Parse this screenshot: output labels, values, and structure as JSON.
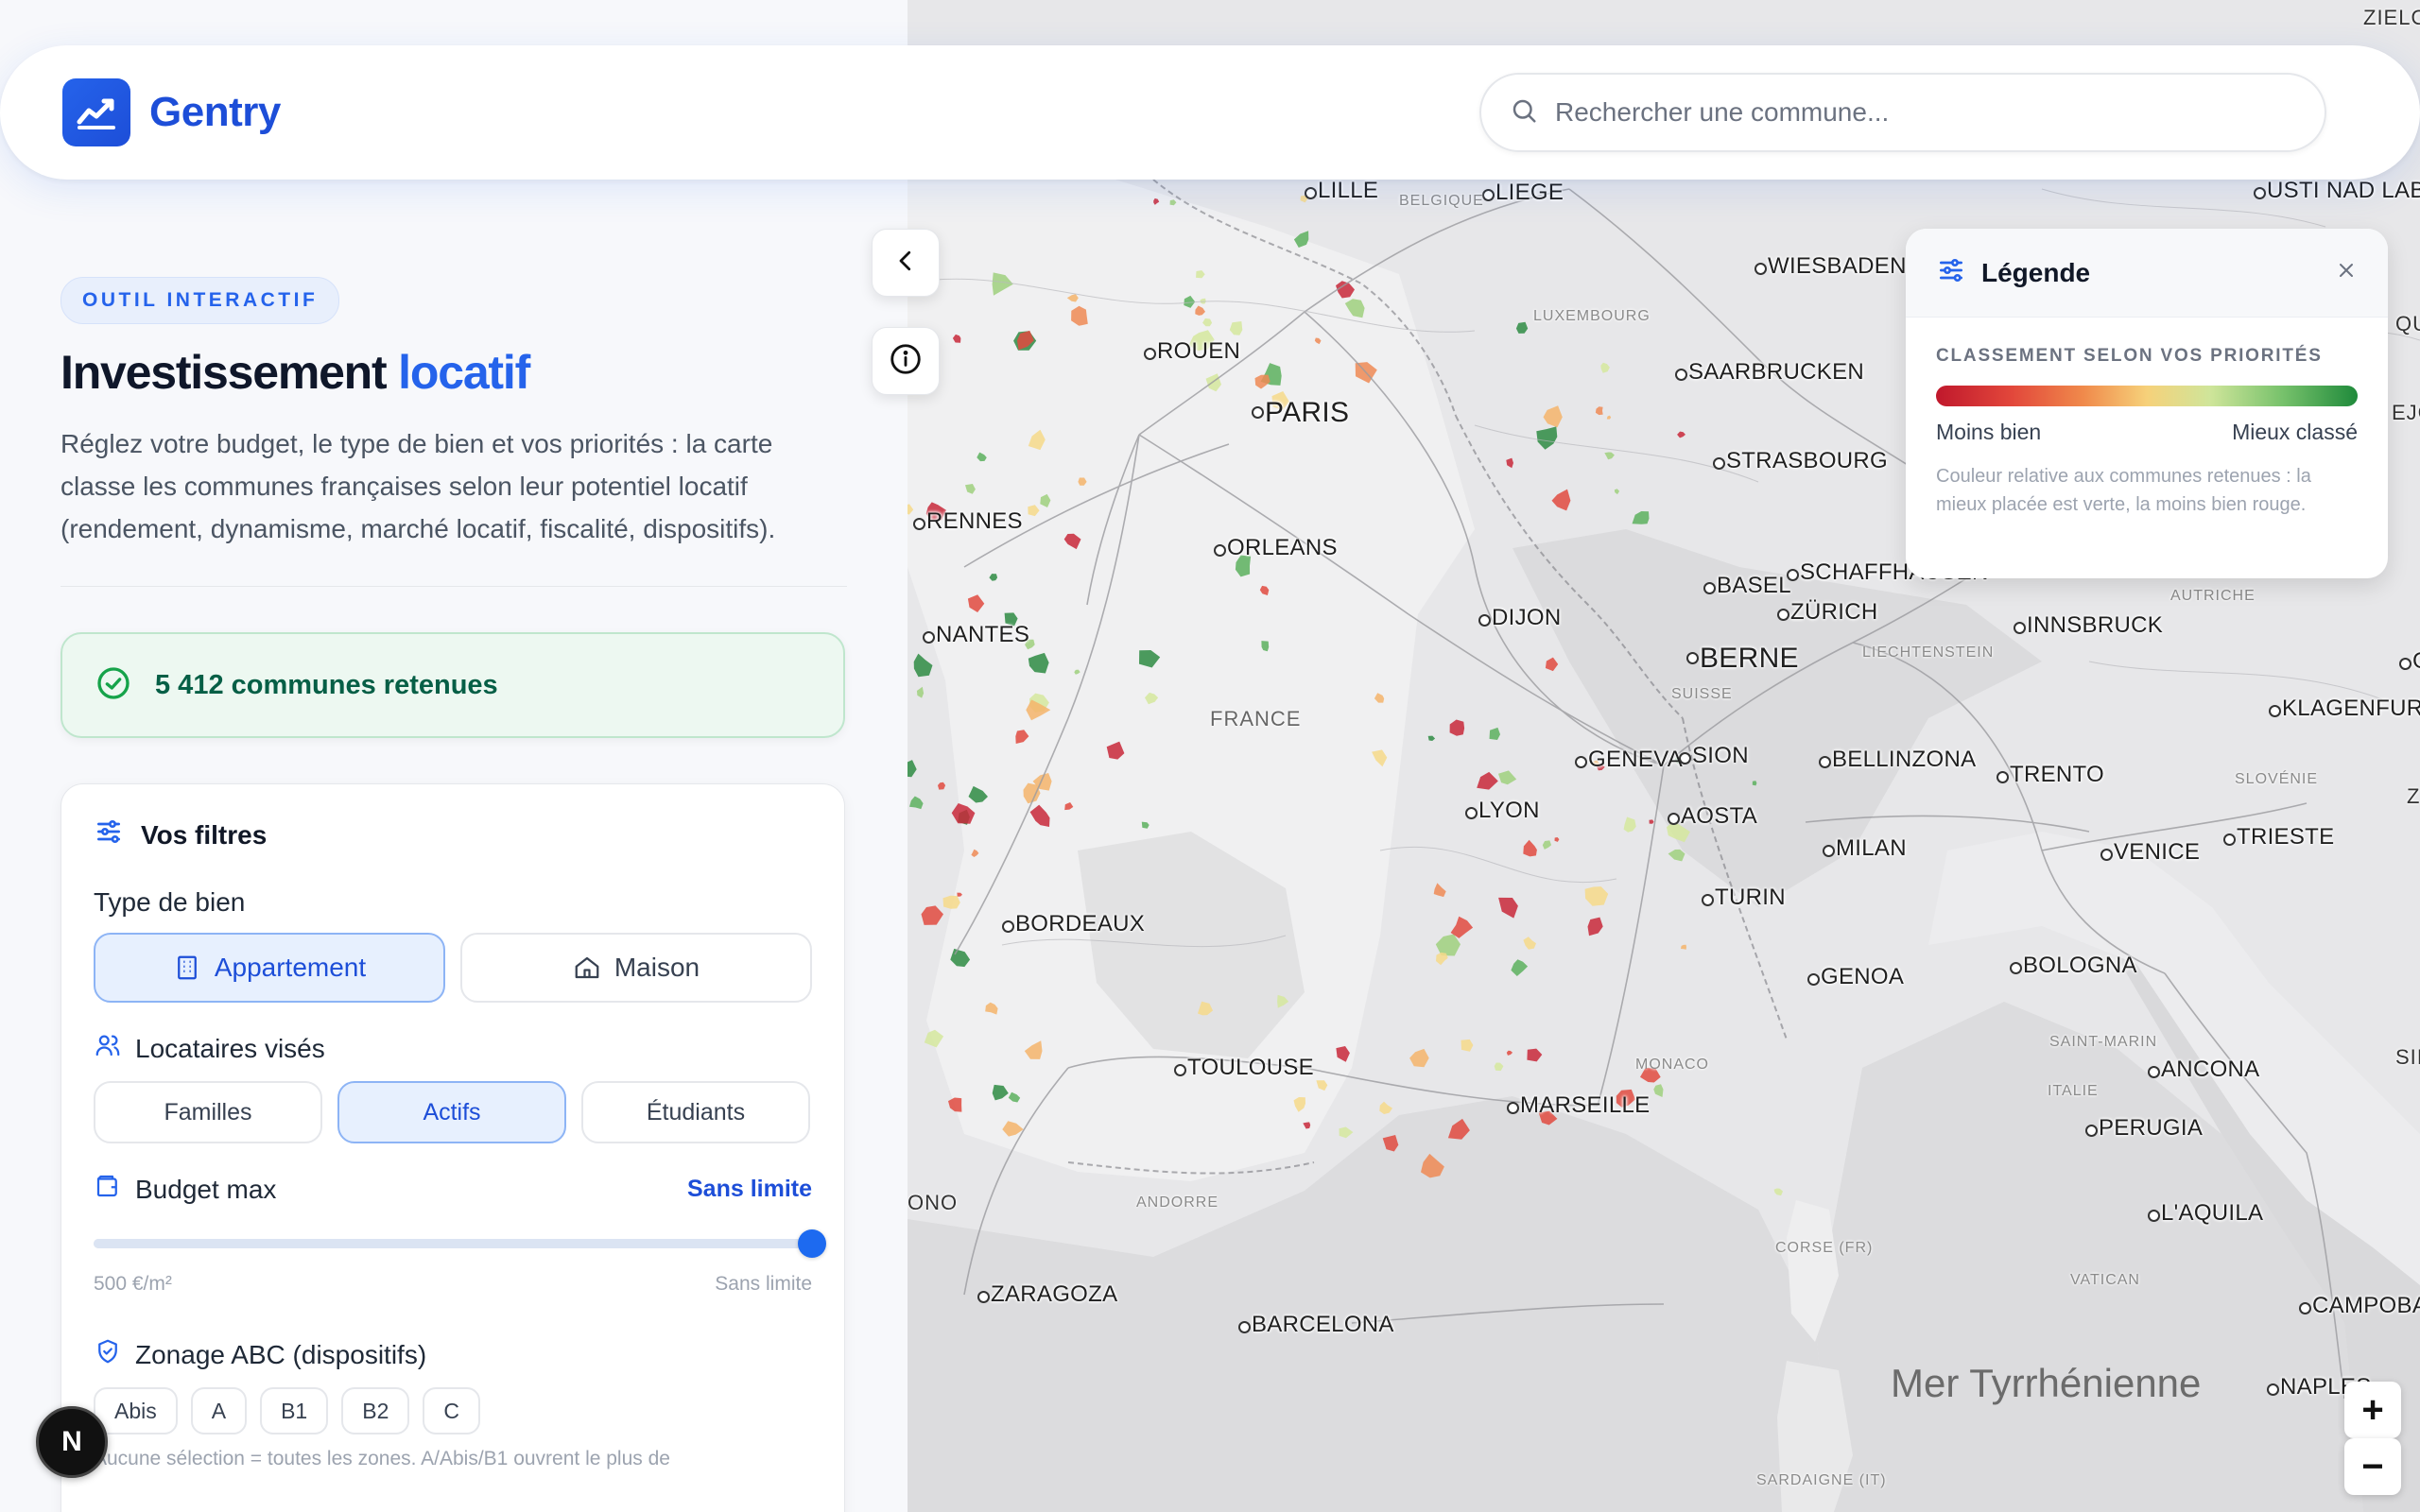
{
  "header": {
    "brand": "Gentry",
    "search_placeholder": "Rechercher une commune..."
  },
  "sidebar": {
    "tag": "OUTIL INTERACTIF",
    "title_main": "Investissement ",
    "title_accent": "locatif",
    "description": "Réglez votre budget, le type de bien et vos priorités : la carte classe les communes françaises selon leur potentiel locatif (rendement, dynamisme, marché locatif, fiscalité, dispositifs).",
    "count_text": "5 412 communes retenues",
    "filters": {
      "title": "Vos filtres",
      "property_type_label": "Type de bien",
      "property_types": [
        {
          "label": "Appartement",
          "active": true,
          "icon": "building-icon"
        },
        {
          "label": "Maison",
          "active": false,
          "icon": "house-icon"
        }
      ],
      "tenants_label": "Locataires visés",
      "tenants": [
        {
          "label": "Familles",
          "active": false
        },
        {
          "label": "Actifs",
          "active": true
        },
        {
          "label": "Étudiants",
          "active": false
        }
      ],
      "budget_label": "Budget max",
      "budget_value": "Sans limite",
      "budget_level": 1.0,
      "budget_min_label": "500 €/m²",
      "budget_max_label": "Sans limite",
      "zoning_label": "Zonage ABC (dispositifs)",
      "zones": [
        "Abis",
        "A",
        "B1",
        "B2",
        "C"
      ],
      "zoning_hint": "Aucune sélection = toutes les zones. A/Abis/B1 ouvrent le plus de"
    }
  },
  "legend": {
    "title": "Légende",
    "caption": "CLASSEMENT SELON VOS PRIORITÉS",
    "low": "Moins bien",
    "high": "Mieux classé",
    "note": "Couleur relative aux communes retenues : la mieux placée est verte, la moins bien rouge."
  },
  "map": {
    "cities": [
      "LILLE",
      "LIEGE",
      "USTI NAD LABEM",
      "WIESBADEN",
      "ROUEN",
      "PARIS",
      "SAARBRUCKEN",
      "STRASBOURG",
      "RENNES",
      "ORLEANS",
      "NANTES",
      "DIJON",
      "BASEL",
      "SCHAFFHAUSEN",
      "ZÜRICH",
      "INNSBRUCK",
      "BERNE",
      "GRAZ",
      "KLAGENFURT",
      "GENEVA",
      "SION",
      "BELLINZONA",
      "TRENTO",
      "AOSTA",
      "LYON",
      "MILAN",
      "VENICE",
      "TRIESTE",
      "BORDEAUX",
      "TURIN",
      "GENOA",
      "BOLOGNA",
      "TOULOUSE",
      "MARSEILLE",
      "ANCONA",
      "PERUGIA",
      "L'AQUILA",
      "ZARAGOZA",
      "BARCELONA",
      "CAMPOBASSO",
      "NAPLES"
    ],
    "regions": [
      "BELGIQUE",
      "LUXEMBOURG",
      "FRANCE",
      "SUISSE",
      "LIECHTENSTEIN",
      "AUTRICHE",
      "SLOVÉNIE",
      "SAINT-MARIN",
      "ITALIE",
      "MONACO",
      "ANDORRE",
      "CORSE (FR)",
      "VATICAN",
      "SARDAIGNE (IT)"
    ],
    "sea": "Mer Tyrrhénienne",
    "edge_labels": [
      "ZIELO",
      "ONO",
      "QUE",
      "EJC",
      "SII",
      "Z"
    ]
  },
  "zoom": {
    "in": "+",
    "out": "−"
  },
  "badge": "N",
  "colors": {
    "accent": "#2563eb",
    "success": "#065f46",
    "rank_low": "#c0182c",
    "rank_high": "#1f8a3b"
  }
}
